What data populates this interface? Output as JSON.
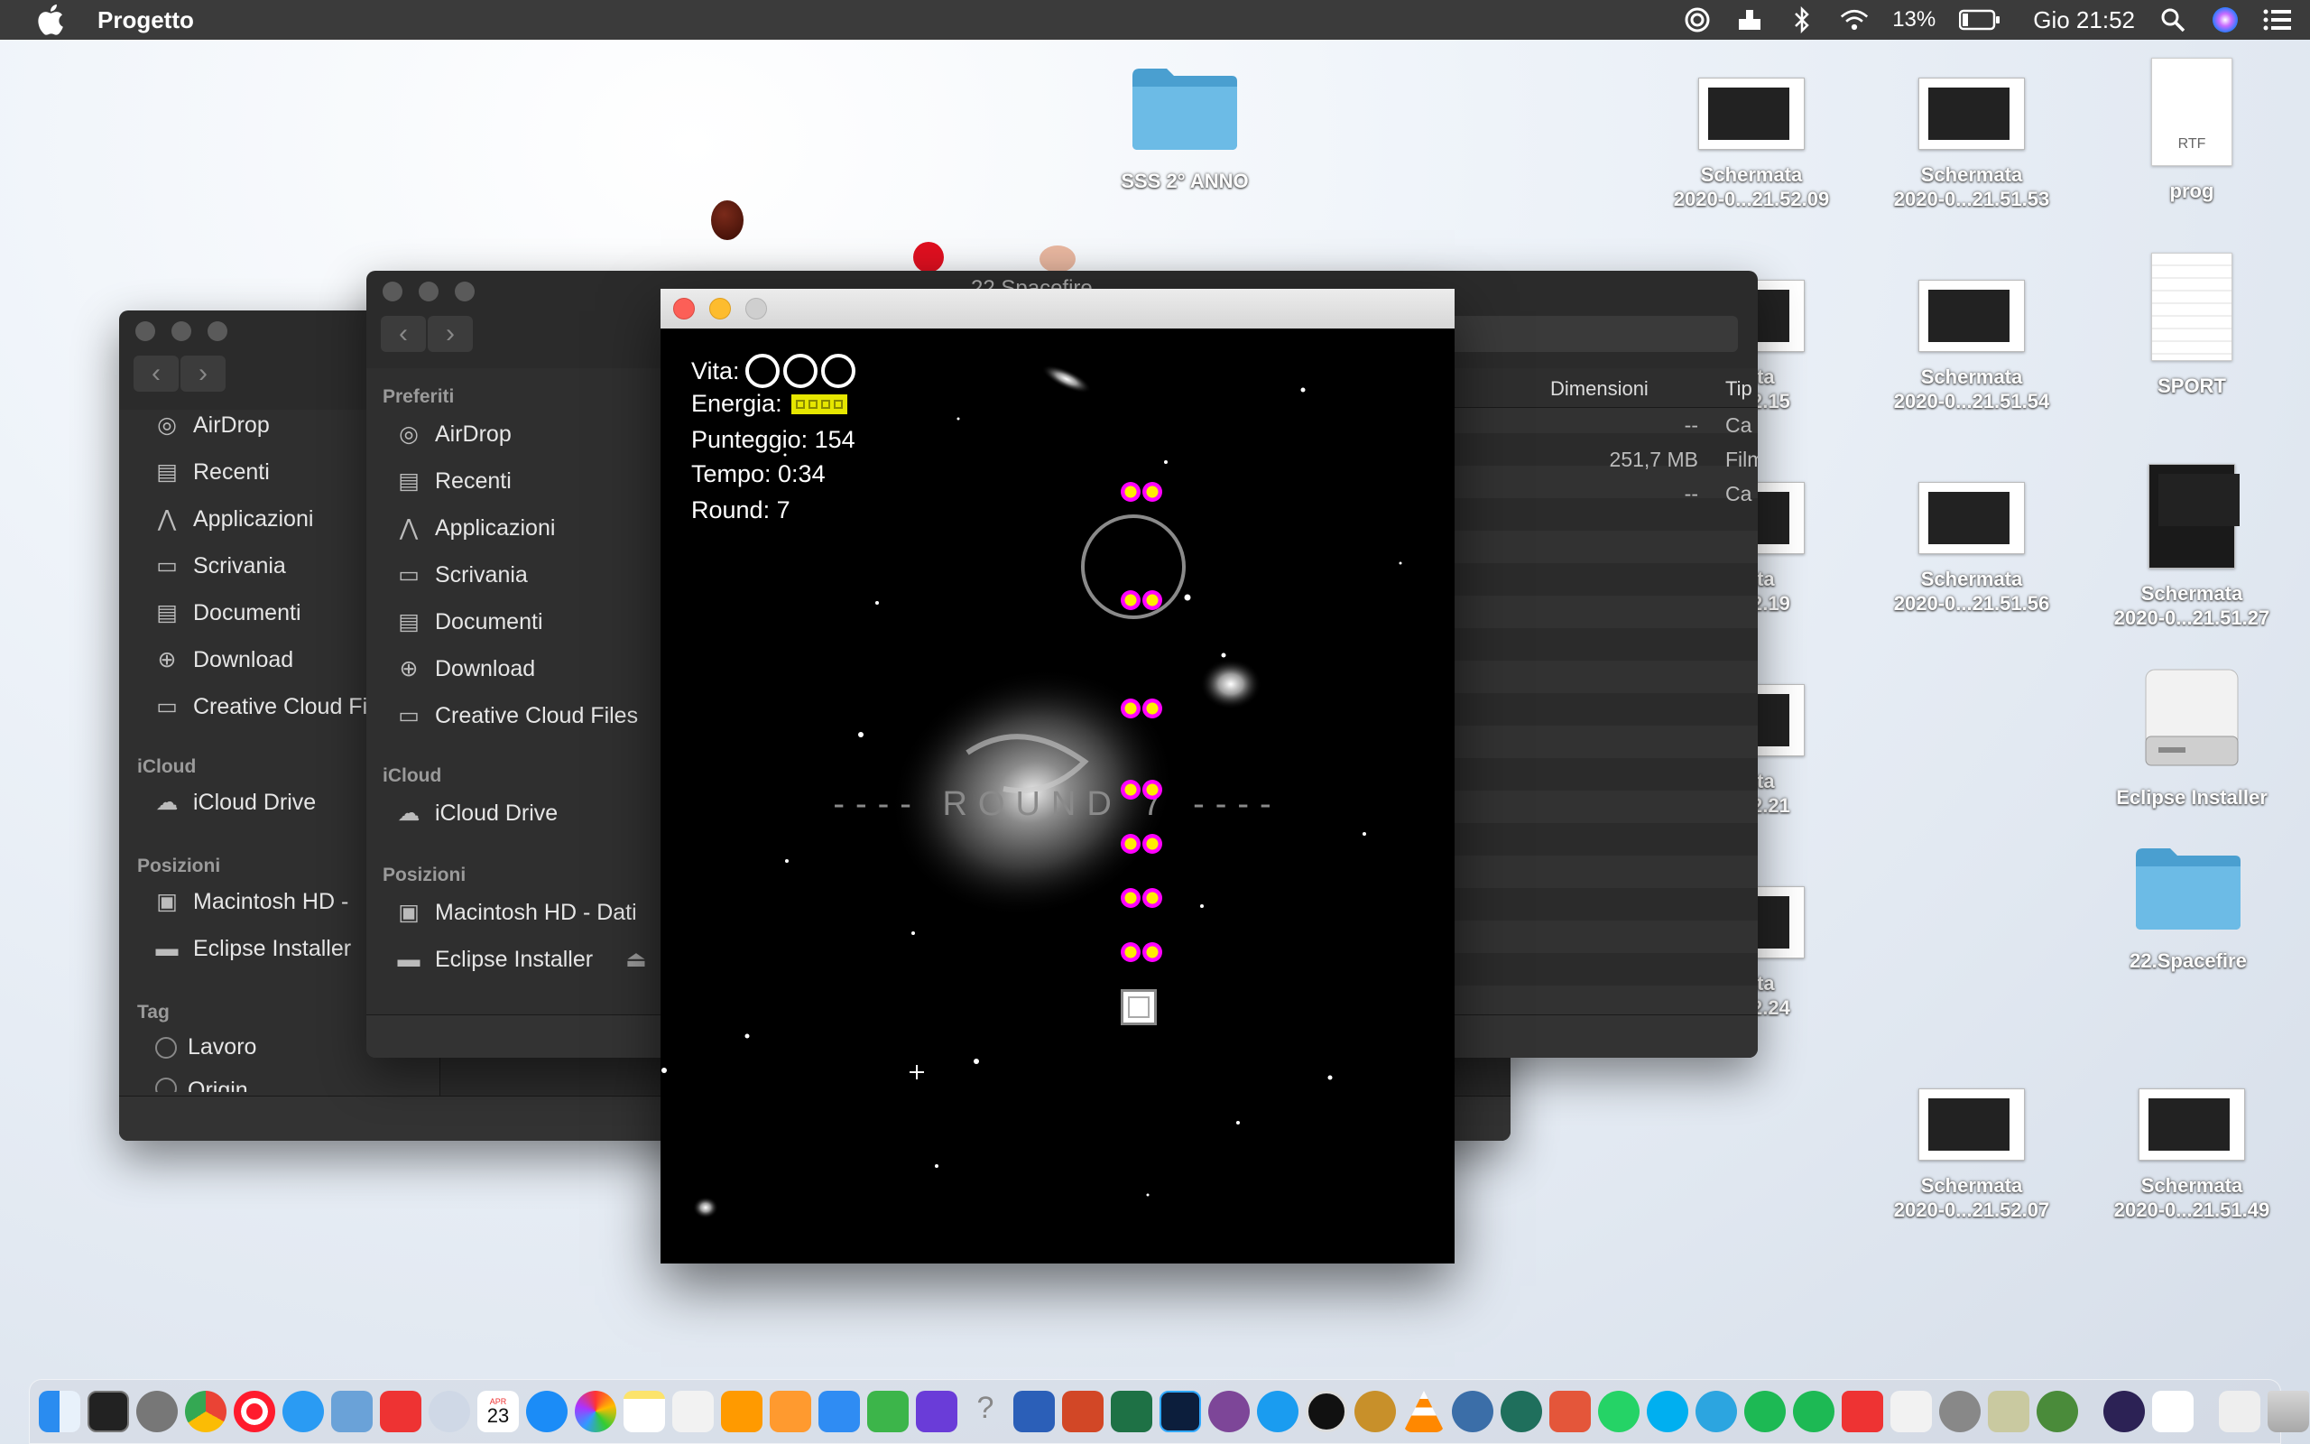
{
  "menubar": {
    "app_name": "Progetto",
    "battery": "13%",
    "clock": "Gio 21:52"
  },
  "desktop": {
    "icons": [
      {
        "label": "SSS 2° ANNO",
        "kind": "folder"
      },
      {
        "label": "Schermata\n2020-0...21.52.09",
        "kind": "screenshot"
      },
      {
        "label": "Schermata\n2020-0...21.51.53",
        "kind": "screenshot"
      },
      {
        "label": "prog",
        "kind": "rtf",
        "badge": "RTF"
      },
      {
        "label": "Schermata\n2020-0...21.51.54",
        "kind": "screenshot"
      },
      {
        "label": "SPORT",
        "kind": "document"
      },
      {
        "label": "Schermata\n2020-0...21.51.56",
        "kind": "screenshot"
      },
      {
        "label": "Schermata\n2020-0...21.51.27",
        "kind": "spacefire-shot"
      },
      {
        "label": "Eclipse Installer",
        "kind": "disk"
      },
      {
        "label": "22.Spacefire",
        "kind": "folder"
      },
      {
        "label": "Schermata\n2020-0...21.52.07",
        "kind": "screenshot"
      },
      {
        "label": "Schermata\n2020-0...21.51.49",
        "kind": "screenshot"
      }
    ],
    "partial_labels": [
      "mata\n21.52.15",
      "mata\n21.52.19",
      "mata\n21.52.21",
      "mata\n21.52.24"
    ]
  },
  "finder_back": {
    "favorites": [
      "AirDrop",
      "Recenti",
      "Applicazioni",
      "Scrivania",
      "Documenti",
      "Download",
      "Creative Cloud Fi"
    ],
    "icloud_header": "iCloud",
    "icloud": [
      "iCloud Drive"
    ],
    "locations_header": "Posizioni",
    "locations": [
      "Macintosh HD -",
      "Eclipse Installer"
    ],
    "tags_header": "Tag",
    "tags": [
      "Lavoro",
      "Origin"
    ]
  },
  "finder_front": {
    "title": "22.Spacefire",
    "favorites_header": "Preferiti",
    "favorites": [
      "AirDrop",
      "Recenti",
      "Applicazioni",
      "Scrivania",
      "Documenti",
      "Download",
      "Creative Cloud Files"
    ],
    "icloud_header": "iCloud",
    "icloud": [
      "iCloud Drive"
    ],
    "locations_header": "Posizioni",
    "locations": [
      "Macintosh HD - Dati",
      "Eclipse Installer"
    ],
    "columns": {
      "size": "Dimensioni",
      "kind": "Tip"
    },
    "rows": [
      {
        "size": "--",
        "kind": "Ca"
      },
      {
        "size": "251,7 MB",
        "kind": "Film"
      },
      {
        "size": "--",
        "kind": "Ca"
      }
    ]
  },
  "game": {
    "lives_label": "Vita:",
    "lives_count": 3,
    "energy_label": "Energia:",
    "energy_segments": 4,
    "score_label": "Punteggio: 154",
    "time_label": "Tempo: 0:34",
    "round_label": "Round: 7",
    "banner": "---- ROUND 7 ----",
    "enemy_pairs": 7,
    "colors": {
      "energy": "#e6e600",
      "enemy_outer": "#ff00ff",
      "enemy_inner": "#ffee00",
      "background": "#000000"
    }
  },
  "dock": {
    "calendar_day": "23",
    "calendar_month": "APR"
  }
}
